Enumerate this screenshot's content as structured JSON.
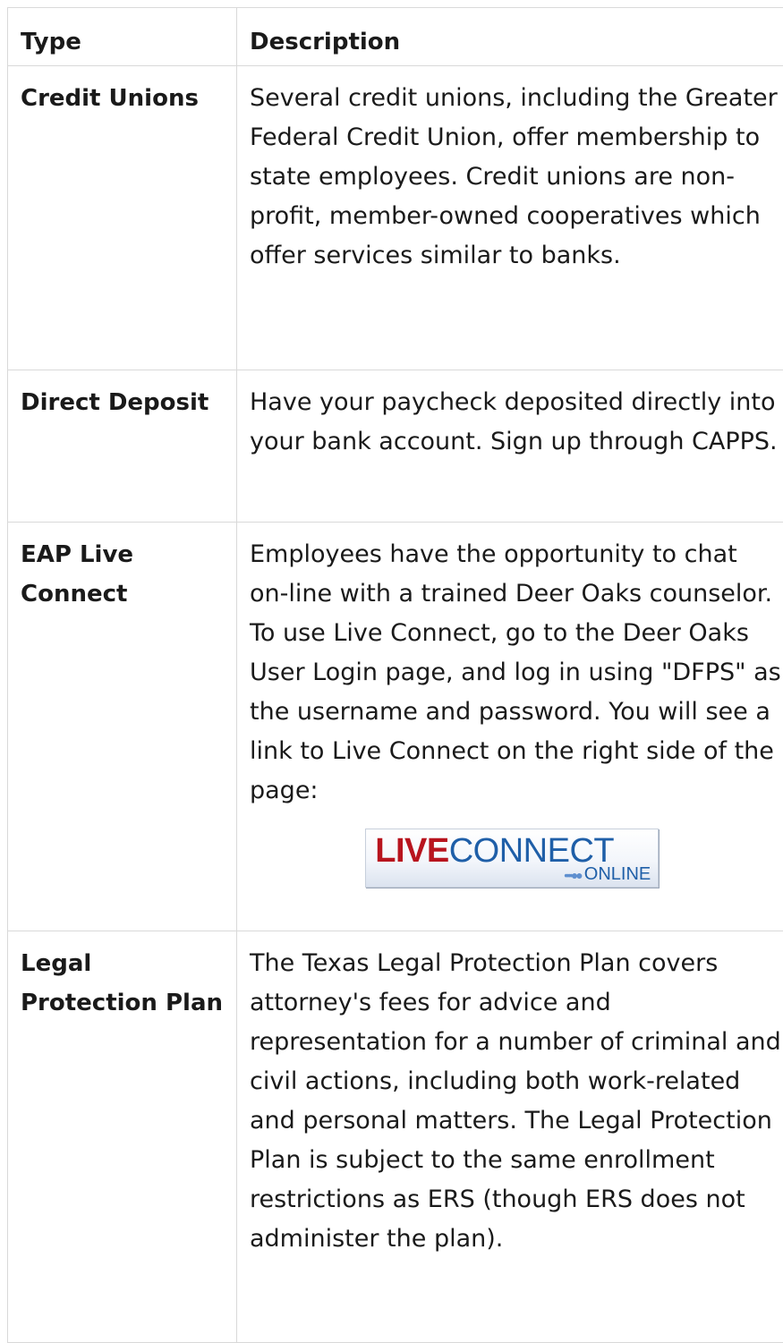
{
  "table": {
    "headers": {
      "type": "Type",
      "description": "Description"
    },
    "rows": [
      {
        "type": "Credit Unions",
        "description": "Several credit unions, including the Greater Federal Credit Union, offer membership to state employees. Credit unions are non-profit, member-owned cooperatives which offer services similar to banks."
      },
      {
        "type": "Direct Deposit",
        "description": "Have your paycheck deposited directly into your bank account. Sign up through CAPPS."
      },
      {
        "type": "EAP Live Connect",
        "description": "Employees have the opportunity to chat on-line with a trained Deer Oaks counselor. To use Live Connect, go to the Deer Oaks User Login page, and log in using \"DFPS\" as the username and password. You will see a link to Live Connect on the right side of the page:",
        "logo": {
          "part1": "LIVE",
          "part2": "CONNECT",
          "sub": "ONLINE",
          "dots": "••••●●",
          "colors": {
            "live": "#b8141e",
            "connect": "#1f5fa8"
          }
        }
      },
      {
        "type": "Legal Protection Plan",
        "description": "The Texas Legal Protection Plan covers attorney's fees for advice and representation for a number of criminal and civil actions, including both work-related and personal matters. The Legal Protection Plan is subject to the same enrollment restrictions as ERS (though ERS does not administer the plan)."
      }
    ]
  },
  "colors": {
    "border": "#d9d9d9",
    "text": "#1a1a1a"
  }
}
